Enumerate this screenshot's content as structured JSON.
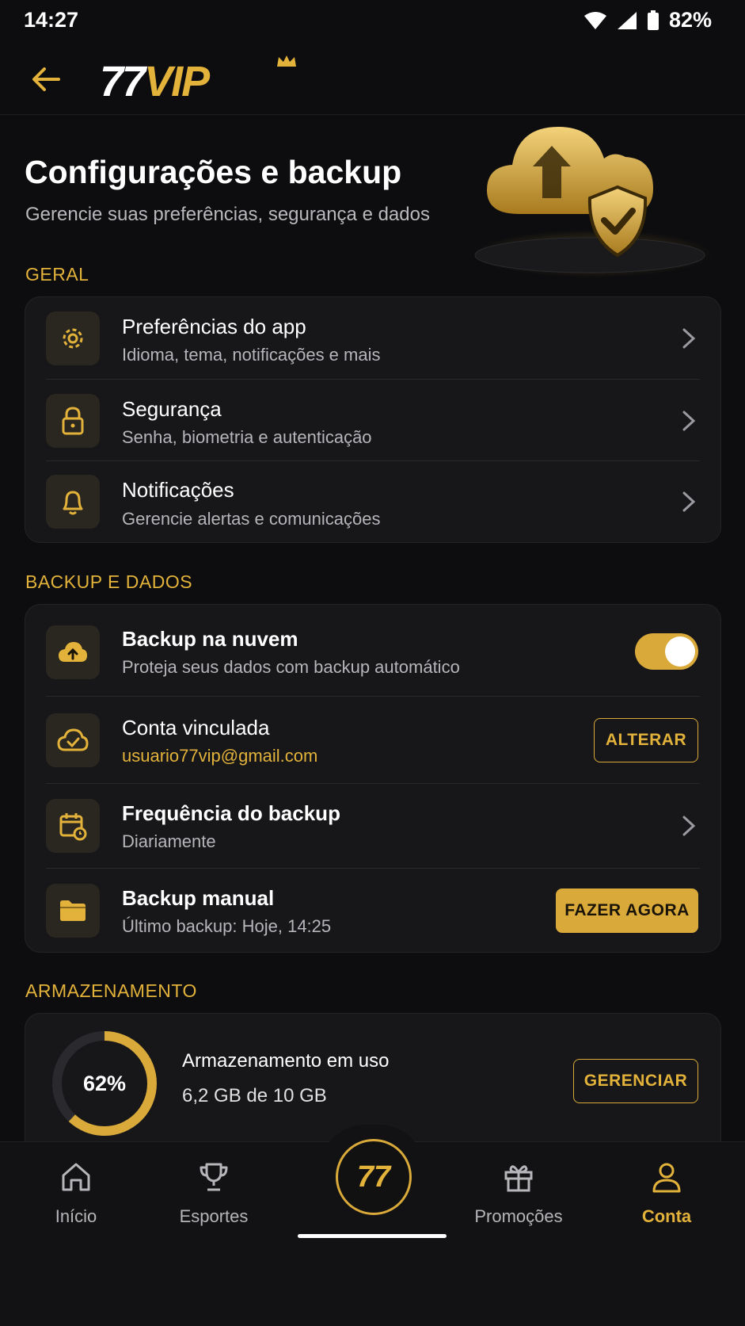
{
  "status_bar": {
    "time": "14:27",
    "battery": "82%"
  },
  "header": {
    "logo_num": "77",
    "logo_text": "VIP"
  },
  "hero": {
    "title": "Configurações e backup",
    "subtitle": "Gerencie suas preferências, segurança e dados"
  },
  "sections": {
    "general": "GERAL",
    "backup": "BACKUP E DADOS",
    "storage": "ARMAZENAMENTO"
  },
  "general_items": [
    {
      "title": "Preferências do app",
      "subtitle": "Idioma, tema, notificações e mais",
      "icon": "gear-icon"
    },
    {
      "title": "Segurança",
      "subtitle": "Senha, biometria e autenticação",
      "icon": "lock-icon"
    },
    {
      "title": "Notificações",
      "subtitle": "Gerencie alertas e comunicações",
      "icon": "bell-icon"
    }
  ],
  "backup_items": {
    "cloud": {
      "title": "Backup na nuvem",
      "subtitle": "Proteja seus dados com backup automático",
      "enabled": true
    },
    "account": {
      "title": "Conta vinculada",
      "email": "usuario77vip@gmail.com",
      "button": "ALTERAR"
    },
    "frequency": {
      "title": "Frequência do backup",
      "value": "Diariamente"
    },
    "manual": {
      "title": "Backup manual",
      "last": "Último backup: Hoje, 14:25",
      "button": "FAZER AGORA"
    }
  },
  "storage": {
    "percent_label": "62%",
    "percent": 62,
    "label": "Armazenamento em uso",
    "usage": "6,2 GB de 10 GB",
    "button": "GERENCIAR"
  },
  "bottom_nav": {
    "home": "Início",
    "sports": "Esportes",
    "center": "77",
    "promos": "Promoções",
    "account": "Conta",
    "active": "account"
  },
  "colors": {
    "accent": "#d9aa3a",
    "background": "#0d0d0f",
    "card": "#17171a"
  }
}
